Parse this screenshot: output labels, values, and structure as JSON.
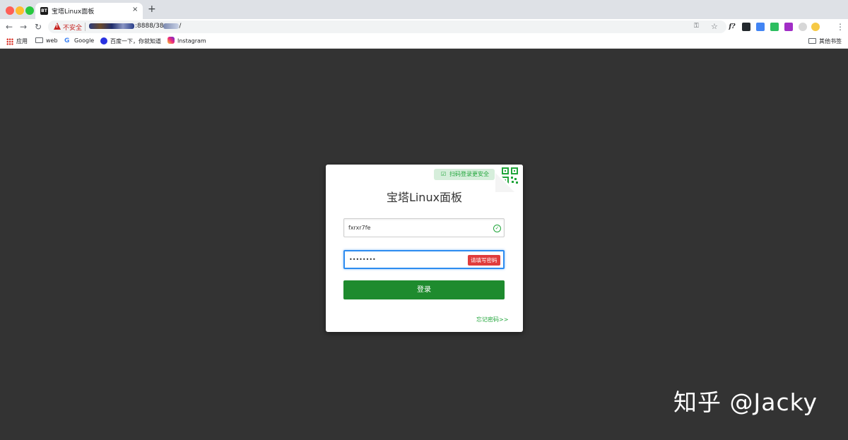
{
  "browser": {
    "tab_title": "宝塔Linux面板",
    "tab_favicon": "BT",
    "tab_close": "×",
    "new_tab": "+",
    "security_label": "不安全",
    "url_visible_prefix": "",
    "url_visible_mid": ":8888/38",
    "url_visible_suffix": "/",
    "nav_icons": [
      "back-arrow-icon",
      "forward-arrow-icon",
      "reload-icon"
    ],
    "extension_f_label": "f?"
  },
  "bookmarks": {
    "items": [
      {
        "label": "应用",
        "icon": "apps-grid-icon"
      },
      {
        "label": "web",
        "icon": "folder-icon"
      },
      {
        "label": "Google",
        "icon": "google-icon"
      },
      {
        "label": "百度一下，你就知道",
        "icon": "baidu-icon"
      },
      {
        "label": "Instagram",
        "icon": "instagram-icon"
      }
    ],
    "other": "其他书签"
  },
  "login": {
    "qr_badge": "扫码登录更安全",
    "title": "宝塔Linux面板",
    "username_value": "fxrxr7fe",
    "password_value": "••••••••",
    "password_error": "请填写密码",
    "submit_label": "登录",
    "forgot_link": "忘记密码>>"
  },
  "watermark": "知乎 @Jacky",
  "colors": {
    "page_background": "#333333",
    "brand_green": "#20a53a",
    "button_green": "#1e8b2e",
    "error_red": "#e03c3c",
    "focus_blue": "#2d8cf0"
  }
}
